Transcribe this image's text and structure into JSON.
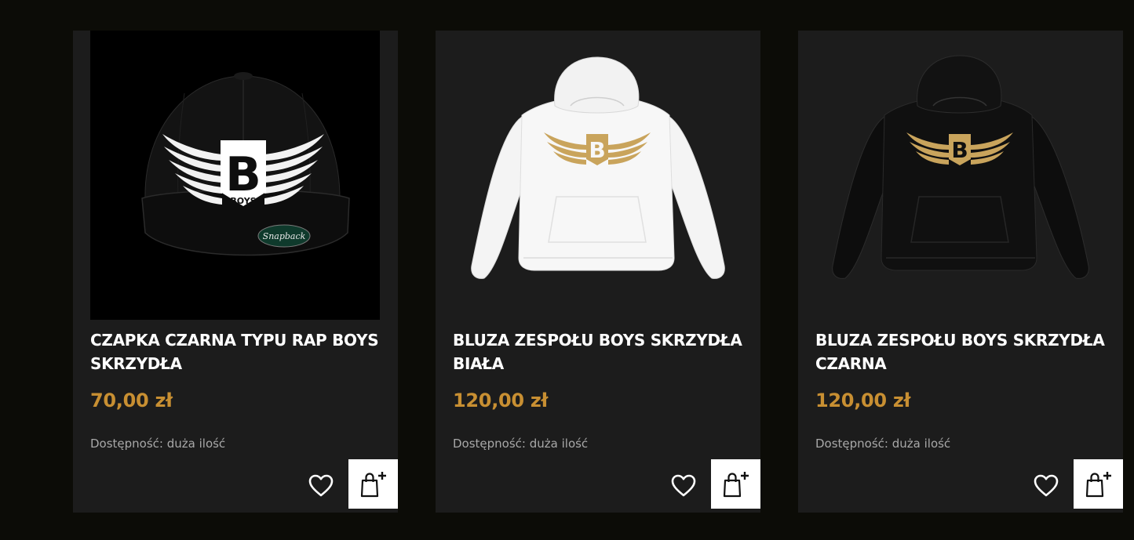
{
  "products": [
    {
      "name": "CZAPKA CZARNA TYPU RAP BOYS SKRZYDŁA",
      "price": "70,00 zł",
      "availability": "Dostępność: duża ilość",
      "image_icon": "black-snapback-cap-with-white-wings-logo",
      "logo_letter": "B",
      "logo_word": "BOYS",
      "badge_text": "Snapback"
    },
    {
      "name": "BLUZA ZESPOŁU BOYS SKRZYDŁA BIAŁA",
      "price": "120,00 zł",
      "availability": "Dostępność: duża ilość",
      "image_icon": "white-hoodie-with-gold-wings-logo",
      "logo_letter": "B"
    },
    {
      "name": "BLUZA ZESPOŁU BOYS SKRZYDŁA CZARNA",
      "price": "120,00 zł",
      "availability": "Dostępność: duża ilość",
      "image_icon": "black-hoodie-with-gold-wings-logo",
      "logo_letter": "B"
    }
  ],
  "actions": {
    "wishlist_icon": "heart-icon",
    "cart_icon": "shopping-bag-plus-icon"
  },
  "colors": {
    "page_background": "#0c0c07",
    "card_background": "#1c1c1c",
    "price": "#c88f32",
    "title": "#ffffff",
    "availability": "#a8a8a8",
    "logo_gold": "#c9a45c"
  }
}
